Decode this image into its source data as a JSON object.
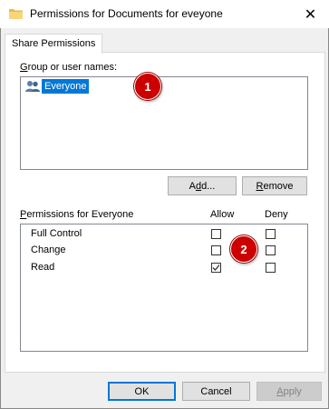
{
  "window": {
    "title": "Permissions for Documents for eveyone",
    "close_glyph": "✕"
  },
  "tab": {
    "label": "Share Permissions"
  },
  "groups": {
    "label_first_letter": "G",
    "label_rest": "roup or user names:",
    "items": [
      {
        "name": "Everyone",
        "icon": "users-icon",
        "selected": true
      }
    ]
  },
  "group_buttons": {
    "add_prefix": "A",
    "add_underlined": "d",
    "add_suffix": "d...",
    "remove_underlined": "R",
    "remove_suffix": "emove"
  },
  "permissions": {
    "label_first_letter": "P",
    "label_rest": "ermissions for Everyone",
    "allow_header": "Allow",
    "deny_header": "Deny",
    "rows": [
      {
        "name": "Full Control",
        "allow": false,
        "deny": false
      },
      {
        "name": "Change",
        "allow": false,
        "deny": false
      },
      {
        "name": "Read",
        "allow": true,
        "deny": false
      }
    ]
  },
  "footer": {
    "ok_label": "OK",
    "cancel_label": "Cancel",
    "apply_prefix": "",
    "apply_underlined": "A",
    "apply_suffix": "pply"
  },
  "annotations": {
    "badge_1": "1",
    "badge_2": "2"
  },
  "colors": {
    "selection": "#0078d7",
    "badge": "#cc0000",
    "dialog_bg": "#f0f0f0"
  }
}
